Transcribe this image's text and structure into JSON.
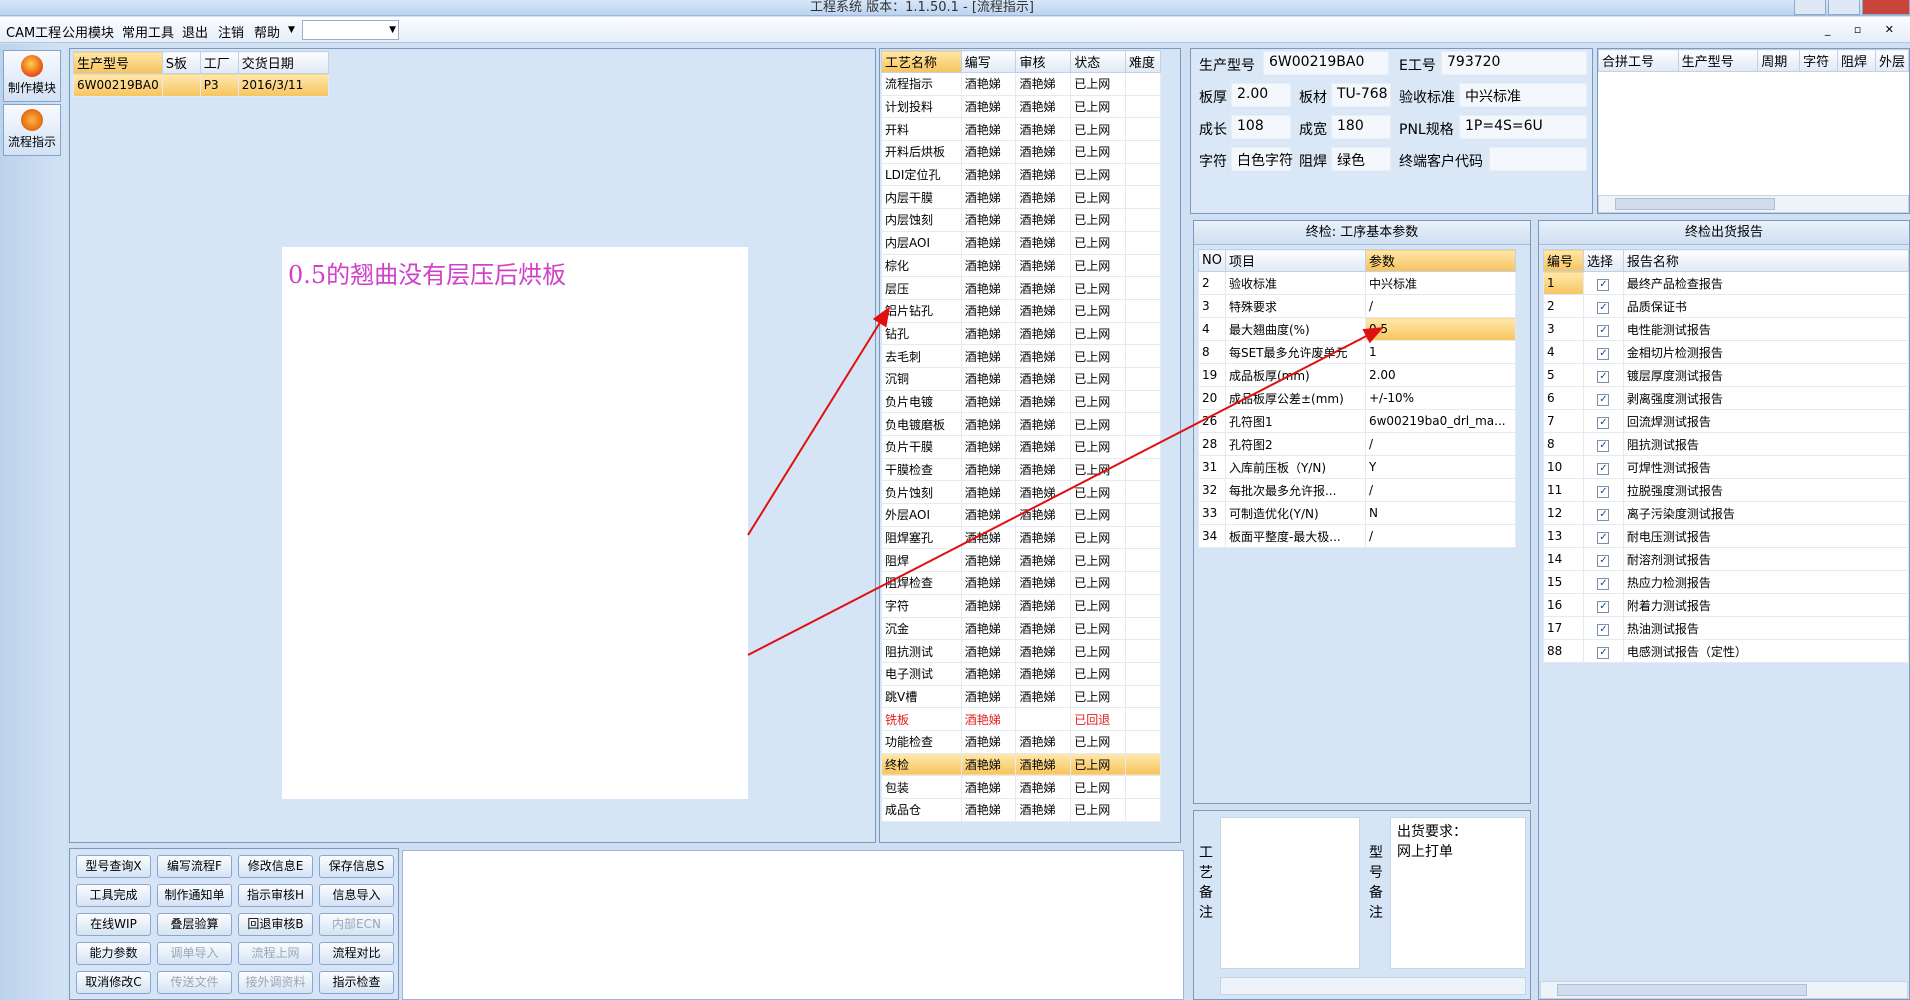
{
  "titlebar": {
    "title": "工程系统  版本：1.1.50.1 - [流程指示]"
  },
  "menu": {
    "items": [
      "CAM工程",
      "公用模块",
      "常用工具",
      "退出",
      "注销",
      "帮助"
    ],
    "combo_value": ""
  },
  "sidebar": {
    "buttons": [
      "制作模块",
      "流程指示"
    ]
  },
  "orders": {
    "headers": [
      "生产型号",
      "S板",
      "工厂",
      "交货日期"
    ],
    "rows": [
      [
        "6W00219BA0",
        "",
        "P3",
        "2016/3/11"
      ]
    ]
  },
  "annotation": {
    "text": "0.5的翘曲没有层压后烘板"
  },
  "flow": {
    "headers": [
      "工艺名称",
      "编写",
      "审核",
      "状态",
      "难度"
    ],
    "rows": [
      [
        "流程指示",
        "酒艳娣",
        "酒艳娣",
        "已上网",
        ""
      ],
      [
        "计划投料",
        "酒艳娣",
        "酒艳娣",
        "已上网",
        ""
      ],
      [
        "开料",
        "酒艳娣",
        "酒艳娣",
        "已上网",
        ""
      ],
      [
        "开料后烘板",
        "酒艳娣",
        "酒艳娣",
        "已上网",
        ""
      ],
      [
        "LDI定位孔",
        "酒艳娣",
        "酒艳娣",
        "已上网",
        ""
      ],
      [
        "内层干膜",
        "酒艳娣",
        "酒艳娣",
        "已上网",
        ""
      ],
      [
        "内层蚀刻",
        "酒艳娣",
        "酒艳娣",
        "已上网",
        ""
      ],
      [
        "内层AOI",
        "酒艳娣",
        "酒艳娣",
        "已上网",
        ""
      ],
      [
        "棕化",
        "酒艳娣",
        "酒艳娣",
        "已上网",
        ""
      ],
      [
        "层压",
        "酒艳娣",
        "酒艳娣",
        "已上网",
        ""
      ],
      [
        "铝片钻孔",
        "酒艳娣",
        "酒艳娣",
        "已上网",
        ""
      ],
      [
        "钻孔",
        "酒艳娣",
        "酒艳娣",
        "已上网",
        ""
      ],
      [
        "去毛刺",
        "酒艳娣",
        "酒艳娣",
        "已上网",
        ""
      ],
      [
        "沉铜",
        "酒艳娣",
        "酒艳娣",
        "已上网",
        ""
      ],
      [
        "负片电镀",
        "酒艳娣",
        "酒艳娣",
        "已上网",
        ""
      ],
      [
        "负电镀磨板",
        "酒艳娣",
        "酒艳娣",
        "已上网",
        ""
      ],
      [
        "负片干膜",
        "酒艳娣",
        "酒艳娣",
        "已上网",
        ""
      ],
      [
        "干膜检查",
        "酒艳娣",
        "酒艳娣",
        "已上网",
        ""
      ],
      [
        "负片蚀刻",
        "酒艳娣",
        "酒艳娣",
        "已上网",
        ""
      ],
      [
        "外层AOI",
        "酒艳娣",
        "酒艳娣",
        "已上网",
        ""
      ],
      [
        "阻焊塞孔",
        "酒艳娣",
        "酒艳娣",
        "已上网",
        ""
      ],
      [
        "阻焊",
        "酒艳娣",
        "酒艳娣",
        "已上网",
        ""
      ],
      [
        "阻焊检查",
        "酒艳娣",
        "酒艳娣",
        "已上网",
        ""
      ],
      [
        "字符",
        "酒艳娣",
        "酒艳娣",
        "已上网",
        ""
      ],
      [
        "沉金",
        "酒艳娣",
        "酒艳娣",
        "已上网",
        ""
      ],
      [
        "阻抗测试",
        "酒艳娣",
        "酒艳娣",
        "已上网",
        ""
      ],
      [
        "电子测试",
        "酒艳娣",
        "酒艳娣",
        "已上网",
        ""
      ],
      [
        "跳V槽",
        "酒艳娣",
        "酒艳娣",
        "已上网",
        ""
      ],
      [
        "铣板",
        "酒艳娣",
        "",
        "已回退",
        ""
      ],
      [
        "功能检查",
        "酒艳娣",
        "酒艳娣",
        "已上网",
        ""
      ],
      [
        "终检",
        "酒艳娣",
        "酒艳娣",
        "已上网",
        ""
      ],
      [
        "包装",
        "酒艳娣",
        "酒艳娣",
        "已上网",
        ""
      ],
      [
        "成品仓",
        "酒艳娣",
        "酒艳娣",
        "已上网",
        ""
      ]
    ],
    "returned_row": 28,
    "selected_row": 30
  },
  "info": {
    "prod_model_label": "生产型号",
    "prod_model": "6W00219BA0",
    "e_no_label": "E工号",
    "e_no": "793720",
    "thickness_label": "板厚",
    "thickness": "2.00",
    "material_label": "板材",
    "material": "TU-768",
    "accept_label": "验收标准",
    "accept": "中兴标准",
    "length_label": "成长",
    "length": "108",
    "width_label": "成宽",
    "width": "180",
    "pnl_label": "PNL规格",
    "pnl": "1P=4S=6U",
    "char_label": "字符",
    "char": "白色字符",
    "mask_label": "阻焊",
    "mask": "绿色",
    "customer_label": "终端客户代码",
    "customer": ""
  },
  "merge": {
    "headers": [
      "合拼工号",
      "生产型号",
      "周期",
      "字符",
      "阻焊",
      "外层"
    ]
  },
  "params": {
    "title": "终检: 工序基本参数",
    "headers": [
      "NO",
      "项目",
      "参数"
    ],
    "rows": [
      [
        "2",
        "验收标准",
        "中兴标准"
      ],
      [
        "3",
        "特殊要求",
        "/"
      ],
      [
        "4",
        "最大翘曲度(%)",
        "0.5"
      ],
      [
        "8",
        "每SET最多允许废单元",
        "1"
      ],
      [
        "19",
        "成品板厚(mm)",
        "2.00"
      ],
      [
        "20",
        "成品板厚公差±(mm)",
        "+/-10%"
      ],
      [
        "26",
        "孔符图1",
        "6w00219ba0_drl_ma..."
      ],
      [
        "28",
        "孔符图2",
        "/"
      ],
      [
        "31",
        "入库前压板（Y/N)",
        "Y"
      ],
      [
        "32",
        "每批次最多允许报...",
        "/"
      ],
      [
        "33",
        "可制造优化(Y/N)",
        "N"
      ],
      [
        "34",
        "板面平整度-最大极...",
        "/"
      ]
    ],
    "selected_row": 2
  },
  "reports": {
    "title": "终检出货报告",
    "headers": [
      "编号",
      "选择",
      "报告名称"
    ],
    "rows": [
      [
        "1",
        "最终产品检查报告"
      ],
      [
        "2",
        "品质保证书"
      ],
      [
        "3",
        "电性能测试报告"
      ],
      [
        "4",
        "金相切片检测报告"
      ],
      [
        "5",
        "镀层厚度测试报告"
      ],
      [
        "6",
        "剥离强度测试报告"
      ],
      [
        "7",
        "回流焊测试报告"
      ],
      [
        "8",
        "阻抗测试报告"
      ],
      [
        "10",
        "可焊性测试报告"
      ],
      [
        "11",
        "拉脱强度测试报告"
      ],
      [
        "12",
        "离子污染度测试报告"
      ],
      [
        "13",
        "耐电压测试报告"
      ],
      [
        "14",
        "耐溶剂测试报告"
      ],
      [
        "15",
        "热应力检测报告"
      ],
      [
        "16",
        "附着力测试报告"
      ],
      [
        "17",
        "热油测试报告"
      ],
      [
        "88",
        "电感测试报告（定性）"
      ]
    ],
    "check_glyph": "✓"
  },
  "notes": {
    "process_label": [
      "工",
      "艺",
      "备",
      "注"
    ],
    "model_label": [
      "型",
      "号",
      "备",
      "注"
    ],
    "ship_req_label": "出货要求：",
    "ship_req_value": "网上打单"
  },
  "buttons": [
    {
      "label": "型号查询X",
      "disabled": false
    },
    {
      "label": "编写流程F",
      "disabled": false
    },
    {
      "label": "修改信息E",
      "disabled": false
    },
    {
      "label": "保存信息S",
      "disabled": false
    },
    {
      "label": "工具完成",
      "disabled": false
    },
    {
      "label": "制作通知单",
      "disabled": false
    },
    {
      "label": "指示审核H",
      "disabled": false
    },
    {
      "label": "信息导入",
      "disabled": false
    },
    {
      "label": "在线WIP",
      "disabled": false
    },
    {
      "label": "叠层验算",
      "disabled": false
    },
    {
      "label": "回退审核B",
      "disabled": false
    },
    {
      "label": "内部ECN",
      "disabled": true
    },
    {
      "label": "能力参数",
      "disabled": false
    },
    {
      "label": "调单导入",
      "disabled": true
    },
    {
      "label": "流程上网",
      "disabled": true
    },
    {
      "label": "流程对比",
      "disabled": false
    },
    {
      "label": "取消修改C",
      "disabled": false
    },
    {
      "label": "传送文件",
      "disabled": true
    },
    {
      "label": "接外调资料",
      "disabled": true
    },
    {
      "label": "指示检查",
      "disabled": false
    }
  ],
  "colors": {
    "arrow": "#e01010",
    "annotation_text": "#d040c8",
    "selected": "#f7c45e",
    "returned": "#e02020"
  }
}
